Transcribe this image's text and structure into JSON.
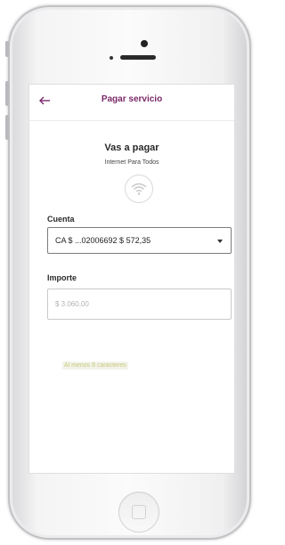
{
  "header": {
    "back_icon": "arrow-left-icon",
    "title": "Pagar servicio"
  },
  "payment": {
    "heading": "Vas a pagar",
    "service": "Internet Para Todos",
    "service_icon": "wifi-icon"
  },
  "account": {
    "label": "Cuenta",
    "selected": "CA $ ...02006692 $ 572,35"
  },
  "amount": {
    "label": "Importe",
    "placeholder": "$ 3.060,00"
  },
  "hint": "Al menos 8 caracteres",
  "colors": {
    "accent": "#7a2a6a",
    "hint": "#c6c97a"
  }
}
